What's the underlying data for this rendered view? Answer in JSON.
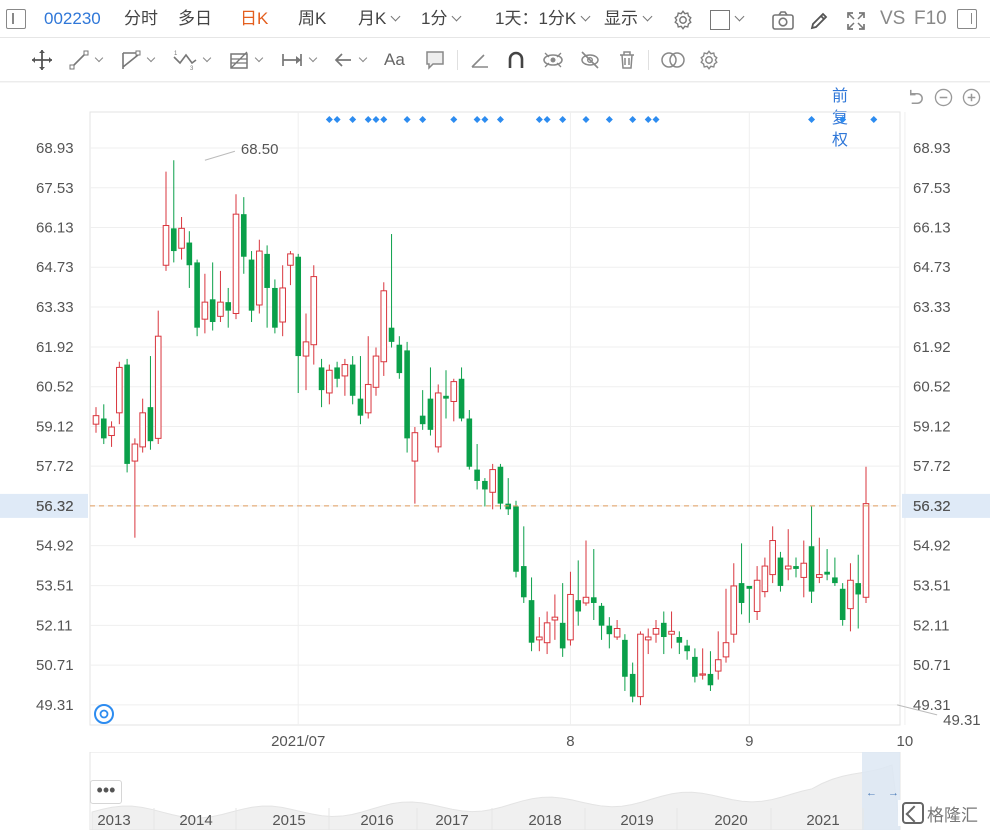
{
  "toolbar": {
    "stock_code": "002230",
    "periods": [
      "分时",
      "多日",
      "日K",
      "周K",
      "月K"
    ],
    "active_period": "日K",
    "minute_select": "1分",
    "multi_select": "1天：1分K",
    "display_select": "显示",
    "vs_label": "VS",
    "f10_label": "F10"
  },
  "draw_tools": {
    "text_tool_label": "Aa"
  },
  "chart_header": {
    "adjust_label": "前复权"
  },
  "chart_data": {
    "type": "candlestick",
    "y_ticks": [
      "68.93",
      "67.53",
      "66.13",
      "64.73",
      "63.33",
      "61.92",
      "60.52",
      "59.12",
      "57.72",
      "56.32",
      "54.92",
      "53.51",
      "52.11",
      "50.71",
      "49.31"
    ],
    "ylim": [
      48.6,
      70.2
    ],
    "x_tick_labels": [
      "2021/07",
      "8",
      "9",
      "10"
    ],
    "x_tick_index": [
      26,
      61,
      84,
      104
    ],
    "current_price_label": "56.32",
    "current_price": 56.32,
    "high_annotation": {
      "label": "68.50",
      "value": 68.5,
      "index": 14
    },
    "low_annotation": {
      "label": "49.31",
      "value": 49.31,
      "index": 103
    },
    "up_color": "#d9363e",
    "down_color": "#0aa04a",
    "event_marker_color": "#2d8cf0",
    "event_marker_index": [
      30,
      31,
      33,
      35,
      36,
      37,
      40,
      42,
      46,
      49,
      50,
      52,
      57,
      58,
      60,
      63,
      66,
      69,
      71,
      72,
      92,
      96,
      100
    ],
    "candles": [
      [
        59.2,
        59.5,
        58.9,
        59.8
      ],
      [
        59.4,
        58.7,
        58.5,
        59.9
      ],
      [
        58.8,
        59.1,
        58.4,
        59.3
      ],
      [
        59.6,
        61.2,
        59.2,
        61.4
      ],
      [
        61.3,
        57.8,
        57.5,
        61.5
      ],
      [
        57.9,
        58.5,
        55.2,
        58.7
      ],
      [
        58.4,
        59.6,
        58.2,
        60.1
      ],
      [
        59.8,
        58.6,
        58.3,
        61.6
      ],
      [
        58.7,
        62.3,
        58.5,
        63.2
      ],
      [
        64.8,
        66.2,
        64.6,
        68.1
      ],
      [
        66.1,
        65.3,
        64.9,
        68.5
      ],
      [
        65.4,
        66.1,
        65.0,
        66.5
      ],
      [
        65.6,
        64.8,
        64.0,
        66.0
      ],
      [
        64.9,
        62.6,
        62.3,
        65.0
      ],
      [
        62.9,
        63.5,
        62.4,
        64.5
      ],
      [
        63.6,
        62.8,
        62.5,
        64.9
      ],
      [
        63.0,
        63.5,
        62.8,
        64.6
      ],
      [
        63.5,
        63.2,
        62.6,
        64.0
      ],
      [
        63.1,
        66.6,
        62.9,
        67.3
      ],
      [
        66.6,
        65.1,
        64.5,
        67.2
      ],
      [
        65.0,
        63.2,
        62.8,
        65.3
      ],
      [
        63.4,
        65.3,
        63.1,
        65.7
      ],
      [
        65.2,
        64.0,
        62.6,
        65.5
      ],
      [
        64.0,
        62.6,
        62.4,
        64.3
      ],
      [
        62.8,
        64.0,
        62.3,
        64.8
      ],
      [
        64.8,
        65.2,
        64.1,
        65.3
      ],
      [
        65.1,
        61.6,
        60.3,
        65.2
      ],
      [
        61.6,
        62.1,
        60.4,
        63.1
      ],
      [
        62.0,
        64.4,
        61.3,
        64.8
      ],
      [
        61.2,
        60.4,
        59.8,
        61.5
      ],
      [
        60.3,
        61.1,
        59.9,
        61.3
      ],
      [
        61.2,
        60.8,
        60.5,
        61.4
      ],
      [
        60.9,
        61.3,
        60.2,
        61.5
      ],
      [
        61.3,
        60.2,
        59.9,
        61.6
      ],
      [
        60.1,
        59.5,
        59.2,
        61.6
      ],
      [
        59.6,
        60.6,
        59.4,
        62.3
      ],
      [
        60.5,
        61.6,
        60.2,
        61.9
      ],
      [
        61.4,
        63.9,
        60.9,
        64.2
      ],
      [
        62.6,
        62.1,
        61.9,
        65.9
      ],
      [
        62.0,
        61.0,
        60.8,
        62.3
      ],
      [
        61.8,
        58.7,
        58.2,
        62.1
      ],
      [
        57.9,
        58.9,
        56.4,
        59.1
      ],
      [
        59.5,
        59.2,
        59.0,
        60.4
      ],
      [
        60.1,
        59.0,
        58.8,
        61.2
      ],
      [
        58.4,
        60.3,
        58.2,
        60.6
      ],
      [
        60.2,
        60.1,
        59.4,
        61.1
      ],
      [
        60.0,
        60.7,
        59.3,
        60.8
      ],
      [
        60.8,
        59.4,
        59.3,
        61.2
      ],
      [
        59.4,
        57.7,
        57.6,
        59.7
      ],
      [
        57.6,
        57.2,
        56.9,
        58.5
      ],
      [
        57.2,
        56.9,
        56.3,
        57.3
      ],
      [
        56.8,
        57.6,
        56.2,
        57.8
      ],
      [
        57.7,
        56.4,
        56.2,
        57.8
      ],
      [
        56.4,
        56.2,
        56.0,
        57.3
      ],
      [
        56.3,
        54.0,
        53.8,
        56.5
      ],
      [
        54.2,
        53.1,
        52.9,
        55.6
      ],
      [
        53.0,
        51.5,
        51.2,
        53.8
      ],
      [
        51.6,
        51.7,
        51.2,
        52.4
      ],
      [
        51.5,
        52.2,
        51.1,
        52.6
      ],
      [
        52.3,
        52.4,
        51.6,
        53.2
      ],
      [
        52.2,
        51.3,
        51.0,
        53.6
      ],
      [
        51.6,
        53.2,
        51.4,
        54.0
      ],
      [
        53.0,
        52.6,
        52.1,
        54.4
      ],
      [
        52.9,
        53.1,
        52.8,
        55.1
      ],
      [
        53.1,
        52.9,
        52.3,
        54.8
      ],
      [
        52.8,
        52.1,
        51.6,
        52.9
      ],
      [
        52.1,
        51.8,
        51.3,
        52.4
      ],
      [
        51.7,
        52.0,
        51.6,
        52.3
      ],
      [
        51.6,
        50.3,
        49.8,
        51.8
      ],
      [
        50.4,
        49.6,
        49.4,
        50.8
      ],
      [
        49.6,
        51.8,
        49.3,
        51.9
      ],
      [
        51.6,
        51.7,
        51.1,
        52.0
      ],
      [
        51.8,
        52.0,
        51.5,
        52.3
      ],
      [
        52.2,
        51.7,
        51.1,
        52.6
      ],
      [
        51.8,
        51.9,
        51.3,
        52.6
      ],
      [
        51.7,
        51.5,
        51.1,
        51.9
      ],
      [
        51.4,
        51.2,
        50.9,
        51.6
      ],
      [
        51.0,
        50.3,
        50.1,
        51.3
      ],
      [
        50.4,
        50.4,
        50.2,
        51.3
      ],
      [
        50.4,
        50.0,
        49.8,
        51.2
      ],
      [
        50.5,
        50.9,
        50.2,
        51.9
      ],
      [
        51.0,
        51.5,
        50.8,
        53.4
      ],
      [
        51.8,
        53.5,
        51.5,
        54.3
      ],
      [
        53.6,
        52.9,
        52.5,
        55.0
      ],
      [
        53.5,
        53.4,
        52.2,
        53.5
      ],
      [
        52.6,
        53.7,
        52.3,
        54.2
      ],
      [
        53.3,
        54.2,
        53.1,
        54.5
      ],
      [
        53.9,
        55.1,
        53.6,
        55.6
      ],
      [
        54.5,
        53.5,
        53.3,
        54.7
      ],
      [
        54.1,
        54.2,
        53.7,
        55.5
      ],
      [
        54.2,
        54.1,
        53.8,
        54.5
      ],
      [
        53.8,
        54.3,
        53.1,
        55.1
      ],
      [
        54.9,
        53.3,
        52.9,
        56.3
      ],
      [
        53.8,
        53.9,
        53.6,
        55.2
      ],
      [
        54.0,
        53.9,
        53.7,
        54.8
      ],
      [
        53.8,
        53.6,
        53.5,
        54.5
      ],
      [
        53.4,
        52.3,
        52.1,
        53.6
      ],
      [
        52.7,
        53.7,
        51.9,
        54.3
      ],
      [
        53.6,
        53.2,
        52.0,
        54.6
      ],
      [
        53.1,
        56.4,
        52.9,
        57.7
      ]
    ]
  },
  "navigator": {
    "years": [
      "2013",
      "2014",
      "2015",
      "2016",
      "2017",
      "2018",
      "2019",
      "2020",
      "2021"
    ],
    "more_label": "•••",
    "left_arrow": "←",
    "right_arrow": "→"
  },
  "watermark": "格隆汇"
}
